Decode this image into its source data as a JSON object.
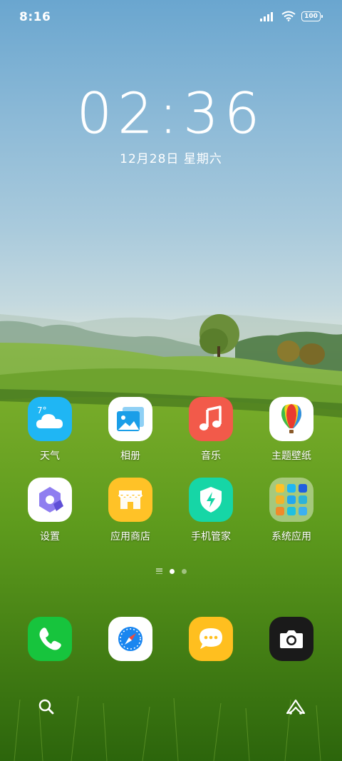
{
  "status_bar": {
    "time": "8:16",
    "battery": "100"
  },
  "lockclock": {
    "time": "02:36",
    "date": "12月28日  星期六"
  },
  "apps": [
    {
      "label": "天气",
      "icon": "weather-icon",
      "temp": "7°"
    },
    {
      "label": "相册",
      "icon": "gallery-icon"
    },
    {
      "label": "音乐",
      "icon": "music-icon"
    },
    {
      "label": "主题壁纸",
      "icon": "themes-icon"
    },
    {
      "label": "设置",
      "icon": "settings-icon"
    },
    {
      "label": "应用商店",
      "icon": "app-store-icon"
    },
    {
      "label": "手机管家",
      "icon": "security-icon"
    },
    {
      "label": "系统应用",
      "icon": "folder-icon"
    }
  ],
  "dock": [
    {
      "icon": "phone-icon"
    },
    {
      "icon": "browser-icon"
    },
    {
      "icon": "messages-icon"
    },
    {
      "icon": "camera-icon"
    }
  ],
  "bottom": {
    "left_icon": "search-icon",
    "right_icon": "assistant-icon"
  },
  "colors": {
    "weather": "#1fb6f4",
    "music": "#f25a4a",
    "app_store": "#ffc227",
    "security": "#16d6a6",
    "phone": "#17c43d",
    "messages": "#ffbf1f",
    "camera": "#1a1a1a"
  }
}
